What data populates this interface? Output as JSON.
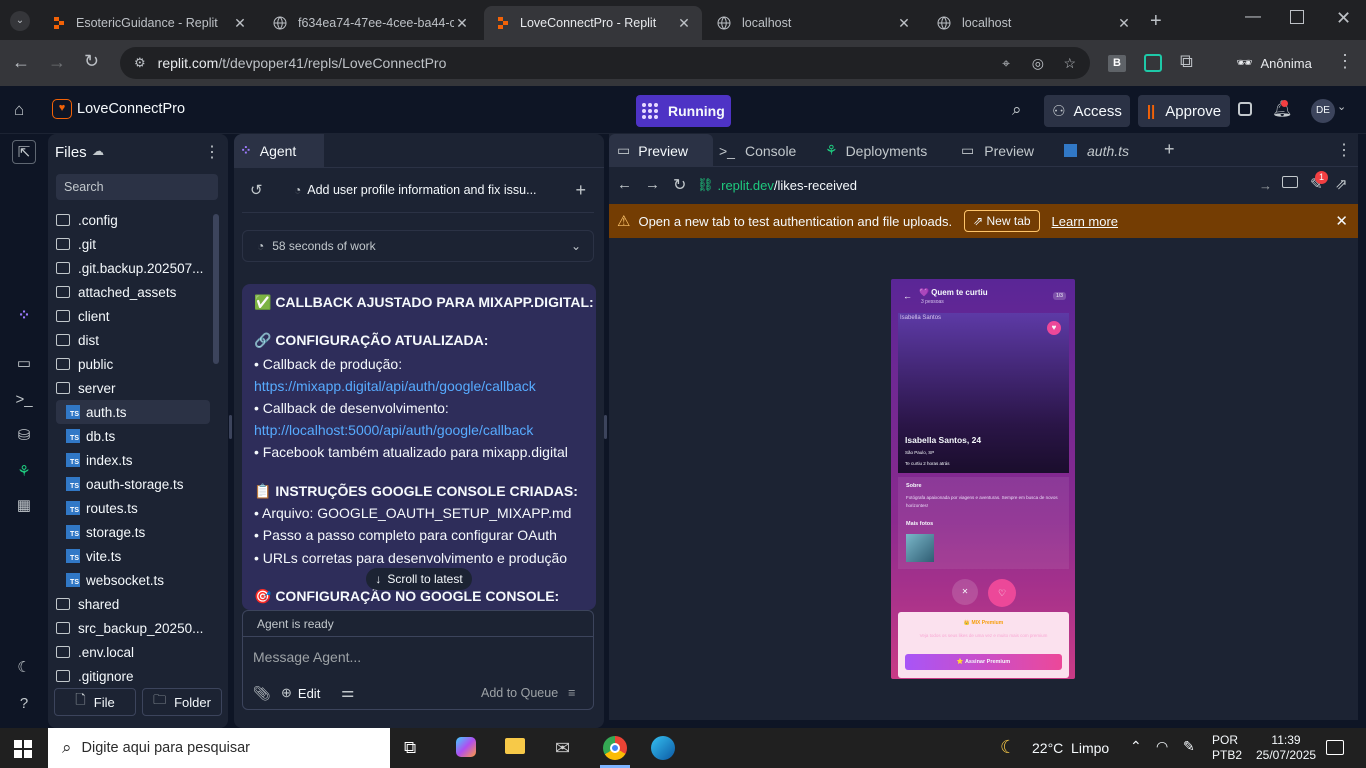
{
  "browser": {
    "tabs": [
      {
        "title": "EsotericGuidance - Replit",
        "active": false
      },
      {
        "title": "f634ea74-47ee-4cee-ba44-c",
        "active": false
      },
      {
        "title": "LoveConnectPro - Replit",
        "active": true
      },
      {
        "title": "localhost",
        "active": false
      },
      {
        "title": "localhost",
        "active": false
      }
    ],
    "url_host": "replit.com",
    "url_path": "/t/devpoper41/repls/LoveConnectPro",
    "profile_label": "Anônima",
    "ext_b": "B"
  },
  "replit": {
    "project_name": "LoveConnectPro",
    "run_status": "Running",
    "access_label": "Access",
    "approve_label": "Approve",
    "avatar_initials": "DE"
  },
  "files": {
    "title": "Files",
    "search_placeholder": "Search",
    "items": [
      {
        "name": ".config",
        "type": "folder"
      },
      {
        "name": ".git",
        "type": "folder"
      },
      {
        "name": ".git.backup.202507...",
        "type": "folder"
      },
      {
        "name": "attached_assets",
        "type": "folder"
      },
      {
        "name": "client",
        "type": "folder"
      },
      {
        "name": "dist",
        "type": "folder"
      },
      {
        "name": "public",
        "type": "folder"
      },
      {
        "name": "server",
        "type": "folder"
      },
      {
        "name": "auth.ts",
        "type": "ts"
      },
      {
        "name": "db.ts",
        "type": "ts"
      },
      {
        "name": "index.ts",
        "type": "ts"
      },
      {
        "name": "oauth-storage.ts",
        "type": "ts"
      },
      {
        "name": "routes.ts",
        "type": "ts"
      },
      {
        "name": "storage.ts",
        "type": "ts"
      },
      {
        "name": "vite.ts",
        "type": "ts"
      },
      {
        "name": "websocket.ts",
        "type": "ts"
      },
      {
        "name": "shared",
        "type": "folder"
      },
      {
        "name": "src_backup_20250...",
        "type": "folder"
      },
      {
        "name": ".env.local",
        "type": "folder"
      },
      {
        "name": ".gitignore",
        "type": "folder"
      }
    ],
    "new_file_label": "File",
    "new_folder_label": "Folder"
  },
  "agent": {
    "tab_label": "Agent",
    "thread_title": "Add user profile information and fix issu...",
    "work_time": "58 seconds of work",
    "lines": [
      {
        "text": "✅ CALLBACK AJUSTADO PARA MIXAPP.DIGITAL:",
        "bold": true,
        "link": false
      },
      {
        "text": "🔗 CONFIGURAÇÃO ATUALIZADA:",
        "bold": true,
        "link": false
      },
      {
        "text": "• Callback de produção:",
        "bold": false,
        "link": false
      },
      {
        "text": "https://mixapp.digital/api/auth/google/callback",
        "bold": false,
        "link": true
      },
      {
        "text": "• Callback de desenvolvimento:",
        "bold": false,
        "link": false
      },
      {
        "text": "http://localhost:5000/api/auth/google/callback",
        "bold": false,
        "link": true
      },
      {
        "text": "• Facebook também atualizado para mixapp.digital",
        "bold": false,
        "link": false
      },
      {
        "text": "📋 INSTRUÇÕES GOOGLE CONSOLE CRIADAS:",
        "bold": true,
        "link": false
      },
      {
        "text": "• Arquivo: GOOGLE_OAUTH_SETUP_MIXAPP.md",
        "bold": false,
        "link": false
      },
      {
        "text": "• Passo a passo completo para configurar OAuth",
        "bold": false,
        "link": false
      },
      {
        "text": "• URLs corretas para desenvolvimento e produção",
        "bold": false,
        "link": false
      },
      {
        "text": "🎯 CONFIGURAÇÃO NO GOOGLE CONSOLE:",
        "bold": true,
        "link": false
      }
    ],
    "scroll_latest": "Scroll to latest",
    "status": "Agent is ready",
    "input_placeholder": "Message Agent...",
    "edit_label": "Edit",
    "queue_label": "Add to Queue"
  },
  "preview": {
    "tabs": [
      "Preview",
      "Console",
      "Deployments",
      "Preview",
      "auth.ts"
    ],
    "url_host": ".replit.dev",
    "url_path": "/likes-received",
    "notif_count": "1",
    "banner_text": "Open a new tab to test authentication and file uploads.",
    "banner_button": "New tab",
    "banner_link": "Learn more",
    "app": {
      "header_title": "💜 Quem te curtiu",
      "header_sub": "3 pessoas",
      "page_badge": "1/3",
      "img_alt": "Isabella Santos",
      "name": "Isabella Santos, 24",
      "location": "São Paulo, SP",
      "liked_time": "Te curtiu 2 horas atrás",
      "about_title": "Sobre",
      "about_text": "Fotógrafa apaixonada por viagens e aventuras. Sempre em busca de novos horizontes!",
      "photos_title": "Mais fotos",
      "premium_title": "👑 MIX Premium",
      "premium_text": "Veja todos os seus likes de uma vez e muito mais com premium",
      "premium_button": "⭐ Assinar Premium"
    }
  },
  "taskbar": {
    "search_placeholder": "Digite aqui para pesquisar",
    "weather": "22°C  Limpo",
    "lang1": "POR",
    "lang2": "PTB2",
    "time": "11:39",
    "date": "25/07/2025"
  }
}
